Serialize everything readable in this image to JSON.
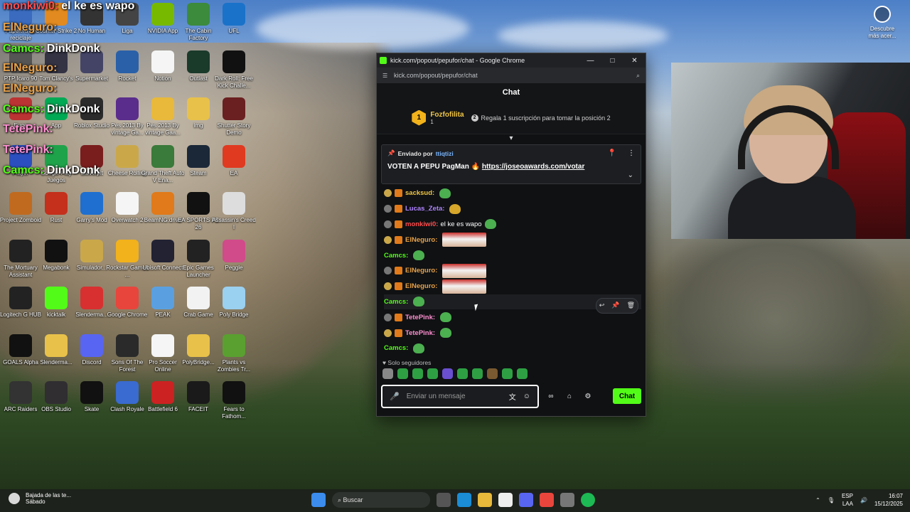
{
  "desktop": {
    "icons": [
      {
        "label": "Papelera de reciclaje",
        "color": "#3a6bbf"
      },
      {
        "label": "Counter-Strike 2",
        "color": "#e28a1f"
      },
      {
        "label": "No Human",
        "color": "#333"
      },
      {
        "label": "Liga",
        "color": "#444"
      },
      {
        "label": "NVIDIA App",
        "color": "#76b900"
      },
      {
        "label": "The Cabin Factory",
        "color": "#3c8a3c"
      },
      {
        "label": "UFL",
        "color": "#1a72c9"
      },
      {
        "label": "PTP Icaro 90",
        "color": "#555"
      },
      {
        "label": "Tom Clancy's",
        "color": "#334"
      },
      {
        "label": "Supermarket",
        "color": "#446"
      },
      {
        "label": "Rocket",
        "color": "#2a60a8"
      },
      {
        "label": "Notion",
        "color": "#f5f5f5"
      },
      {
        "label": "Outlast",
        "color": "#1a3a2a"
      },
      {
        "label": "Dark Roll: Free Kick Challe...",
        "color": "#111"
      },
      {
        "label": "Euge",
        "color": "#b33"
      },
      {
        "label": "App",
        "color": "#0a5"
      },
      {
        "label": "Roblox Studio",
        "color": "#2b2b2b"
      },
      {
        "label": "Pes 2013 By vintage Ga...",
        "color": "#5a2d8c"
      },
      {
        "label": "Pes 2013 By vintage Gaa...",
        "color": "#e8b93a"
      },
      {
        "label": "img",
        "color": "#e8c14a"
      },
      {
        "label": "Shutter Story Demo",
        "color": "#6a2020"
      },
      {
        "label": "Player",
        "color": "#2b4fbf"
      },
      {
        "label": "Google Play Juegos",
        "color": "#1fa34a"
      },
      {
        "label": "Cloverpit",
        "color": "#7a1d1d"
      },
      {
        "label": "Cheese Rolling",
        "color": "#caa84a"
      },
      {
        "label": "Grand Theft Auto V Ena...",
        "color": "#3a7a3a"
      },
      {
        "label": "Steam",
        "color": "#1b2838"
      },
      {
        "label": "EA",
        "color": "#e03a20"
      },
      {
        "label": "Project Zomboid",
        "color": "#c06a20"
      },
      {
        "label": "Rust",
        "color": "#c4301c"
      },
      {
        "label": "Garry's Mod",
        "color": "#1e6fd0"
      },
      {
        "label": "Overwatch 2",
        "color": "#f5f5f5"
      },
      {
        "label": "BeamNG.drive",
        "color": "#e07a1a"
      },
      {
        "label": "EA SPORTS FC 26",
        "color": "#111"
      },
      {
        "label": "Assassin's Creed I",
        "color": "#ddd"
      },
      {
        "label": "The Mortuary Assistant",
        "color": "#222"
      },
      {
        "label": "Megabonk",
        "color": "#111"
      },
      {
        "label": "Simulador...",
        "color": "#caa84a"
      },
      {
        "label": "Rockstar Games ...",
        "color": "#f2b21b"
      },
      {
        "label": "Ubisoft Connect",
        "color": "#223"
      },
      {
        "label": "Epic Games Launcher",
        "color": "#222"
      },
      {
        "label": "Peggle",
        "color": "#d14a8a"
      },
      {
        "label": "Logitech G HUB",
        "color": "#222"
      },
      {
        "label": "kicktalk",
        "color": "#53fc18"
      },
      {
        "label": "Slenderma...",
        "color": "#d83030"
      },
      {
        "label": "Google Chrome",
        "color": "#e8453c"
      },
      {
        "label": "PEAK",
        "color": "#5aa0e0"
      },
      {
        "label": "Crab Game",
        "color": "#f2f2f2"
      },
      {
        "label": "Poly Bridge",
        "color": "#9ad0f0"
      },
      {
        "label": "GOALS Alpha",
        "color": "#111"
      },
      {
        "label": "Slenderma...",
        "color": "#e8c14a"
      },
      {
        "label": "Discord",
        "color": "#5865f2"
      },
      {
        "label": "Sons Of The Forest",
        "color": "#2a2a2a"
      },
      {
        "label": "Pro Soccer Online",
        "color": "#f5f5f5"
      },
      {
        "label": "PolyBridge...",
        "color": "#e8c14a"
      },
      {
        "label": "Plants vs Zombies Tr...",
        "color": "#5aa030"
      },
      {
        "label": "ARC Raiders",
        "color": "#333"
      },
      {
        "label": "OBS Studio",
        "color": "#302e31"
      },
      {
        "label": "Skate",
        "color": "#111"
      },
      {
        "label": "Clash Royale",
        "color": "#3a6bd0"
      },
      {
        "label": "Battlefield 6",
        "color": "#c22"
      },
      {
        "label": "FACEIT",
        "color": "#1a1a1a"
      },
      {
        "label": "Fears to Fathom...",
        "color": "#111"
      }
    ],
    "discover_label": "Descubre más acer..."
  },
  "overlay": [
    {
      "user": "monkiwi0:",
      "text": "el ke es wapo",
      "color": "#ff4d4d"
    },
    {
      "user": "ElNeguro:",
      "text": "",
      "color": "#e7a14a"
    },
    {
      "user": "Camcs:",
      "text": "DinkDonk",
      "color": "#53fc18"
    },
    {
      "user": "ElNeguro:",
      "text": "",
      "color": "#e7a14a"
    },
    {
      "user": "ElNeguro:",
      "text": "",
      "color": "#e7a14a"
    },
    {
      "user": "Camcs:",
      "text": "DinkDonk",
      "color": "#53fc18"
    },
    {
      "user": "TetePink:",
      "text": "",
      "color": "#ff8fd0"
    },
    {
      "user": "TetePink:",
      "text": "",
      "color": "#ff8fd0"
    },
    {
      "user": "Camcs:",
      "text": "DinkDonk",
      "color": "#53fc18"
    }
  ],
  "window": {
    "title": "kick.com/popout/pepufor/chat - Google Chrome",
    "url": "kick.com/popout/pepufor/chat",
    "minimize": "—",
    "maximize": "□",
    "close": "✕"
  },
  "chat": {
    "header": "Chat",
    "leader": {
      "rank": "1",
      "name": "Fozfofilita",
      "count": "1",
      "hint_num": "2",
      "hint": "Regala 1 suscripción para tomar la posición 2"
    },
    "pinned": {
      "by_label": "Enviado por",
      "by_user": "ttiqtizi",
      "message": "VOTEN A PEPU PagMan 🔥",
      "link": "https://joseoawards.com/votar"
    },
    "messages": [
      {
        "user": "sacksud:",
        "color": "#f2c744",
        "text": "",
        "emote": "pepe"
      },
      {
        "user": "Lucas_Zeta:",
        "color": "#b084ff",
        "text": "",
        "emote": "coin"
      },
      {
        "user": "monkiwi0:",
        "color": "#ff4d4d",
        "text": "el ke es wapo",
        "emote": "pepe"
      },
      {
        "user": "ElNeguro:",
        "color": "#e7a14a",
        "text": "",
        "emote": "img"
      },
      {
        "user": "Camcs:",
        "color": "#53fc18",
        "text": "",
        "emote": "pepe"
      },
      {
        "user": "ElNeguro:",
        "color": "#e7a14a",
        "text": "",
        "emote": "img"
      },
      {
        "user": "ElNeguro:",
        "color": "#e7a14a",
        "text": "",
        "emote": "img"
      },
      {
        "user": "Camcs:",
        "color": "#53fc18",
        "text": "",
        "emote": "pepe"
      },
      {
        "user": "TetePink:",
        "color": "#ff8fd0",
        "text": "",
        "emote": "pepe"
      },
      {
        "user": "TetePink:",
        "color": "#ff8fd0",
        "text": "",
        "emote": "pepe"
      },
      {
        "user": "Camcs:",
        "color": "#53fc18",
        "text": "",
        "emote": "pepe"
      }
    ],
    "followers_only": "Solo seguidores",
    "input_placeholder": "Enviar un mensaje",
    "send_label": "Chat"
  },
  "taskbar": {
    "weather_title": "Bajada de las te...",
    "weather_sub": "Sábado",
    "weather_badge": "4",
    "search_placeholder": "Buscar",
    "lang": "ESP",
    "lang_sub": "LAA",
    "time": "16:07",
    "date": "15/12/2025"
  },
  "colors": {
    "kick_green": "#53fc18",
    "chat_bg": "#0f1113"
  }
}
